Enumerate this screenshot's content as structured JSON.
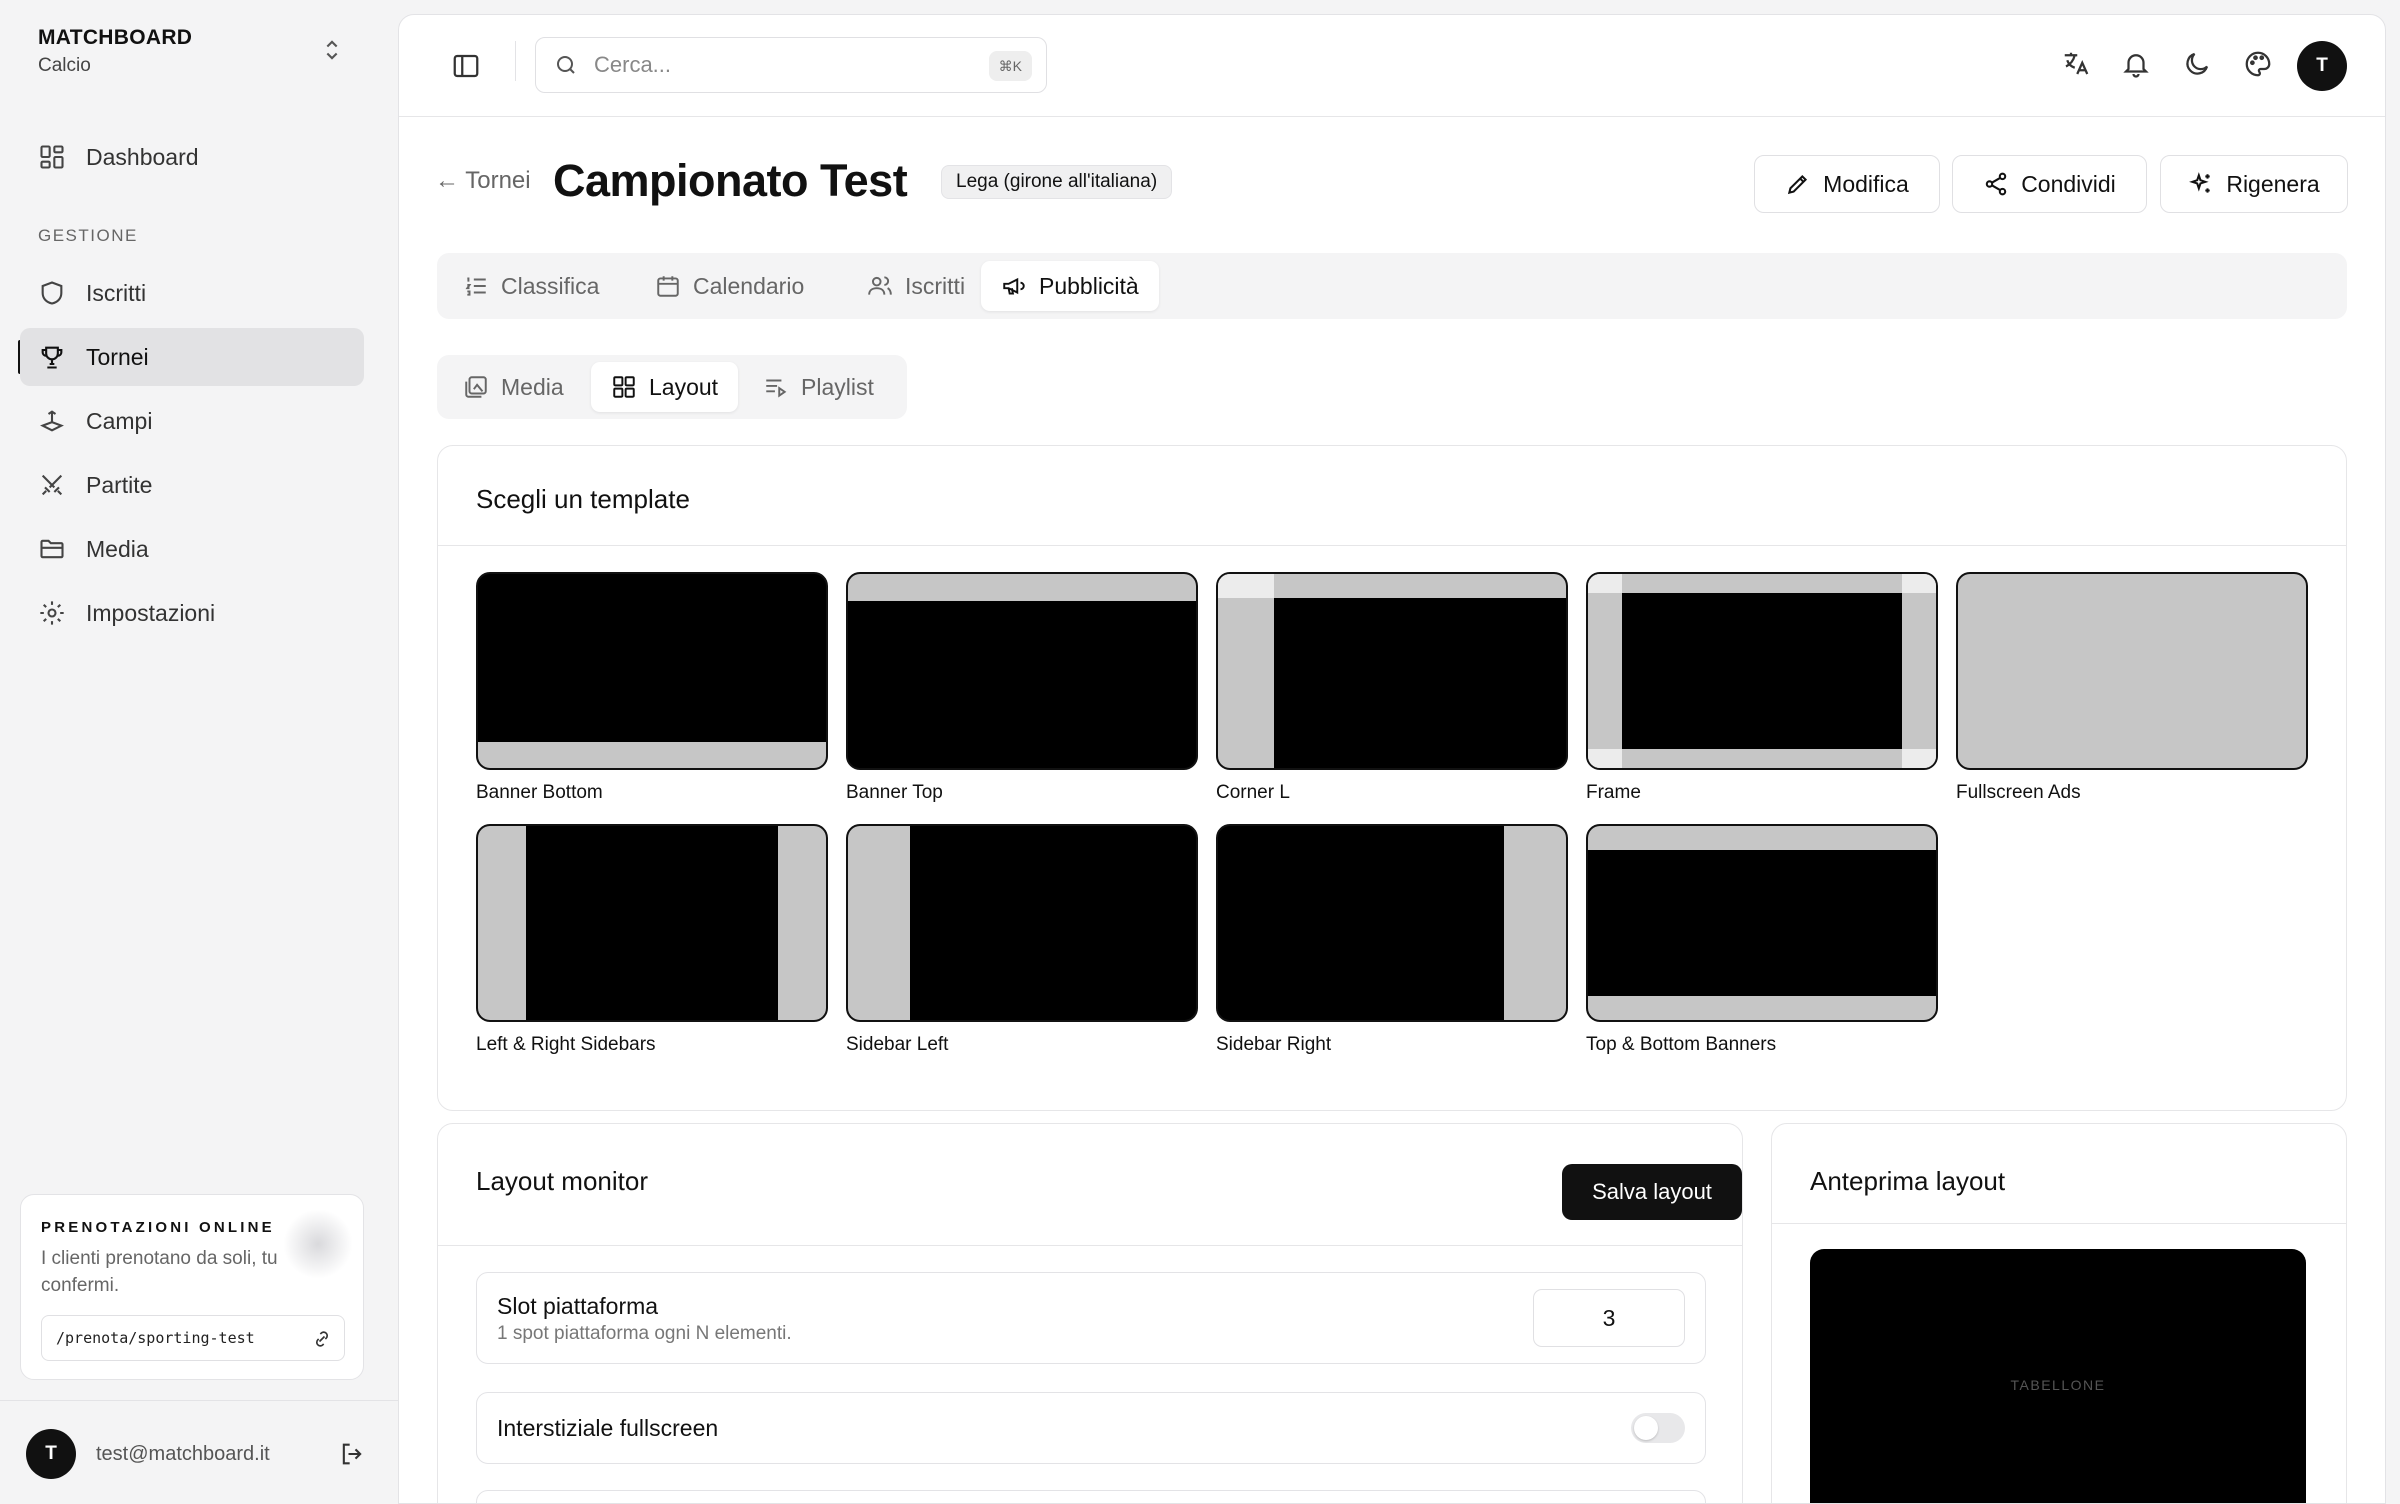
{
  "app": {
    "name": "MATCHBOARD",
    "sport": "Calcio"
  },
  "sidebar": {
    "dashboard": "Dashboard",
    "section_label": "GESTIONE",
    "items": [
      {
        "label": "Iscritti",
        "icon": "shield-icon"
      },
      {
        "label": "Tornei",
        "icon": "trophy-icon",
        "active": true
      },
      {
        "label": "Campi",
        "icon": "field-icon"
      },
      {
        "label": "Partite",
        "icon": "swords-icon"
      },
      {
        "label": "Media",
        "icon": "folder-icon"
      },
      {
        "label": "Impostazioni",
        "icon": "gear-icon"
      }
    ],
    "promo": {
      "title": "PRENOTAZIONI ONLINE",
      "text": "I clienti prenotano da soli, tu confermi.",
      "url": "/prenota/sporting-test"
    },
    "user": {
      "initial": "T",
      "email": "test@matchboard.it"
    }
  },
  "topbar": {
    "search_placeholder": "Cerca...",
    "shortcut": "⌘K",
    "avatar_initial": "T"
  },
  "page": {
    "back_label": "← Tornei",
    "title": "Campionato Test",
    "badge": "Lega (girone all'italiana)",
    "actions": {
      "edit": "Modifica",
      "share": "Condividi",
      "regenerate": "Rigenera"
    }
  },
  "tabs": [
    "Classifica",
    "Calendario",
    "Iscritti",
    "Pubblicità"
  ],
  "active_tab": "Pubblicità",
  "subtabs": [
    "Media",
    "Layout",
    "Playlist"
  ],
  "active_subtab": "Layout",
  "templates": {
    "title": "Scegli un template",
    "items": [
      "Banner Bottom",
      "Banner Top",
      "Corner L",
      "Frame",
      "Fullscreen Ads",
      "Left & Right Sidebars",
      "Sidebar Left",
      "Sidebar Right",
      "Top & Bottom Banners"
    ]
  },
  "layout_monitor": {
    "title": "Layout monitor",
    "save_label": "Salva layout",
    "slot_title": "Slot piattaforma",
    "slot_sub": "1 spot piattaforma ogni N elementi.",
    "slot_value": "3",
    "interstitial_title": "Interstiziale fullscreen",
    "interstitial_on": false
  },
  "preview": {
    "title": "Anteprima layout",
    "screen_label": "TABELLONE"
  },
  "colors": {
    "accent": "#111111",
    "ad_area": "#c6c6c6",
    "screen": "#000000"
  }
}
